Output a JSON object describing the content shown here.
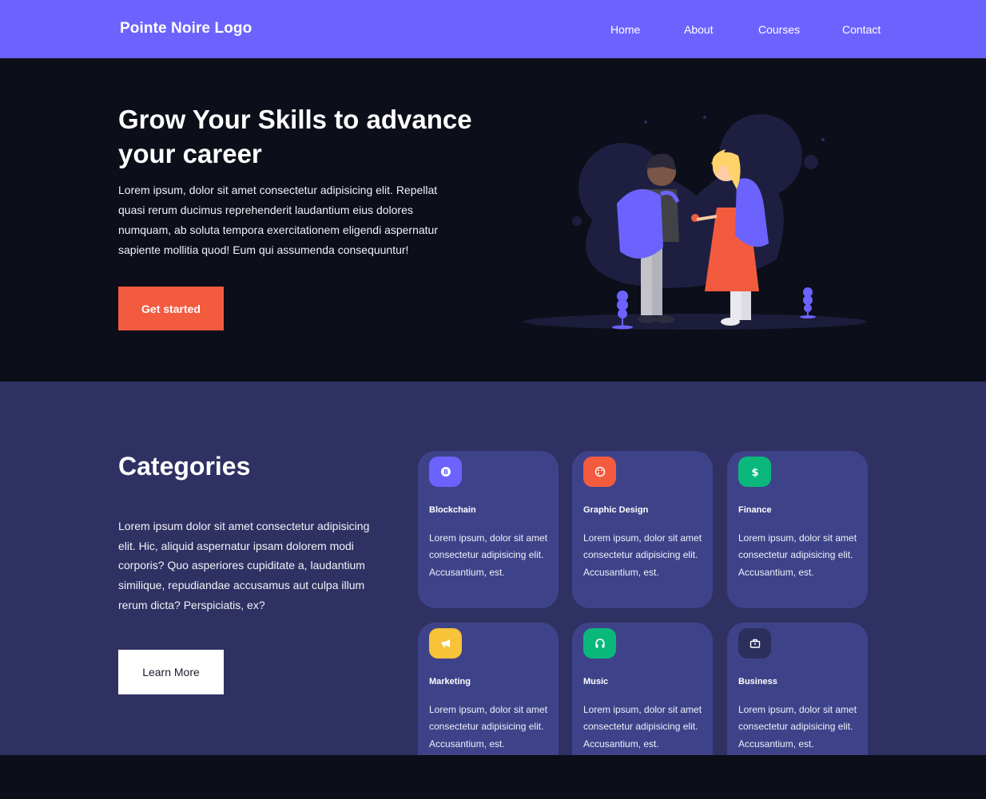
{
  "nav": {
    "logo": "Pointe Noire Logo",
    "links": [
      "Home",
      "About",
      "Courses",
      "Contact"
    ]
  },
  "hero": {
    "title": "Grow Your Skills to advance your career",
    "text": "Lorem ipsum, dolor sit amet consectetur adipisicing elit. Repellat quasi rerum ducimus reprehenderit laudantium eius dolores numquam, ab soluta tempora exercitationem eligendi aspernatur sapiente mollitia quod! Eum qui assumenda consequuntur!",
    "cta": "Get started",
    "illustration": "two-students-with-backpacks"
  },
  "categories": {
    "title": "Categories",
    "text": "Lorem ipsum dolor sit amet consectetur adipisicing elit. Hic, aliquid aspernatur ipsam dolorem modi corporis? Quo asperiores cupiditate a, laudantium similique, repudiandae accusamus aut culpa illum rerum dicta? Perspiciatis, ex?",
    "cta": "Learn More",
    "cards": [
      {
        "title": "Blockchain",
        "text": "Lorem ipsum, dolor sit amet consectetur adipisicing elit. Accusantium, est.",
        "icon": "bitcoin-icon",
        "color": "#6c63ff"
      },
      {
        "title": "Graphic Design",
        "text": "Lorem ipsum, dolor sit amet consectetur adipisicing elit. Accusantium, est.",
        "icon": "palette-icon",
        "color": "#f35b3f"
      },
      {
        "title": "Finance",
        "text": "Lorem ipsum, dolor sit amet consectetur adipisicing elit. Accusantium, est.",
        "icon": "dollar-icon",
        "color": "#0bb87c"
      },
      {
        "title": "Marketing",
        "text": "Lorem ipsum, dolor sit amet consectetur adipisicing elit. Accusantium, est.",
        "icon": "megaphone-icon",
        "color": "#f7c338"
      },
      {
        "title": "Music",
        "text": "Lorem ipsum, dolor sit amet consectetur adipisicing elit. Accusantium, est.",
        "icon": "headphones-icon",
        "color": "#0bb87c"
      },
      {
        "title": "Business",
        "text": "Lorem ipsum, dolor sit amet consectetur adipisicing elit. Accusantium, est.",
        "icon": "briefcase-icon",
        "color": "#2c2e5c"
      }
    ]
  },
  "colors": {
    "nav": "#6c63ff",
    "hero_bg": "#0c0e19",
    "section_bg": "#2f3163",
    "card_bg": "#3e4389",
    "accent": "#f35b3f"
  }
}
